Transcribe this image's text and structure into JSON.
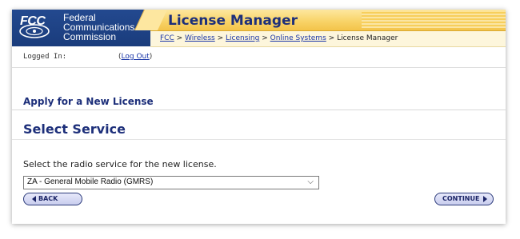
{
  "header": {
    "logo_mark": "FCC",
    "logo_lines": [
      "Federal",
      "Communications",
      "Commission"
    ],
    "title": "License Manager",
    "breadcrumb": [
      {
        "label": "FCC",
        "link": true
      },
      {
        "label": "Wireless",
        "link": true
      },
      {
        "label": "Licensing",
        "link": true
      },
      {
        "label": "Online Systems",
        "link": true
      },
      {
        "label": "License Manager",
        "link": false
      }
    ],
    "separator": ">"
  },
  "session": {
    "logged_in_label": "Logged In:",
    "logout_label": "Log Out",
    "open_paren": "(",
    "close_paren": ")"
  },
  "section_title": "Apply for a New License",
  "page_title": "Select Service",
  "instruction": "Select the radio service for the new license.",
  "service_select": {
    "selected": "ZA - General Mobile Radio (GMRS)"
  },
  "buttons": {
    "back": "BACK",
    "continue": "CONTINUE"
  },
  "colors": {
    "brand_blue": "#1d2f7a",
    "logo_bg": "#1a3c7c",
    "title_bar": "#f8d265",
    "link": "#1a36a8"
  }
}
